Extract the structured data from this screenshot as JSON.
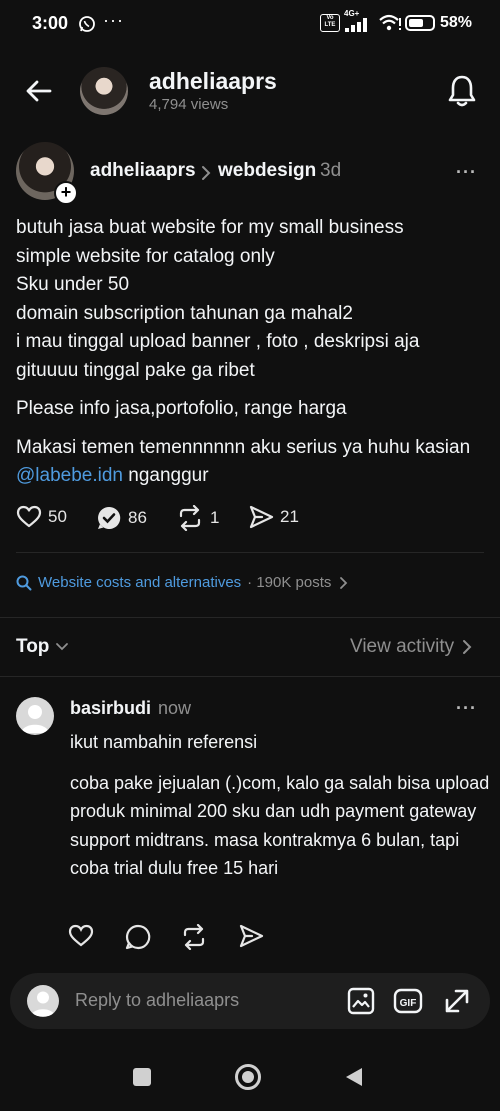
{
  "status_bar": {
    "time": "3:00",
    "dots": "···",
    "network": "4G+",
    "volte": "Vo LTE",
    "battery": "58%"
  },
  "header": {
    "name": "adheliaaprs",
    "views": "4,794 views"
  },
  "post": {
    "author": "adheliaaprs",
    "topic": "webdesign",
    "time": "3d",
    "paragraph1": "butuh jasa buat website for my small business\nsimple website for catalog only\nSku under 50\ndomain subscription tahunan ga mahal2\ni mau tinggal upload banner , foto , deskripsi aja\ngituuuu tinggal pake ga ribet",
    "paragraph2": "Please info jasa,portofolio, range harga",
    "paragraph3_start": "Makasi temen temennnnnn aku serius ya huhu kasian ",
    "mention": "@labebe.idn",
    "paragraph3_end": " nganggur",
    "likes": "50",
    "comments": "86",
    "reposts": "1",
    "shares": "21"
  },
  "related": {
    "title": "Website costs and alternatives",
    "count": "· 190K posts"
  },
  "sort": {
    "label": "Top",
    "view_activity": "View activity"
  },
  "reply": {
    "author": "basirbudi",
    "time": "now",
    "line1": "ikut nambahin referensi",
    "line2": "coba pake jejualan (.)com, kalo ga salah bisa upload produk minimal 200 sku dan udh payment gateway support midtrans. masa kontrakmya 6 bulan, tapi coba trial dulu free 15 hari"
  },
  "composer": {
    "placeholder": "Reply to adheliaaprs",
    "gif": "GIF"
  },
  "colors": {
    "background": "#101010",
    "link": "#4f9bdf",
    "muted": "#8f8f8f"
  }
}
